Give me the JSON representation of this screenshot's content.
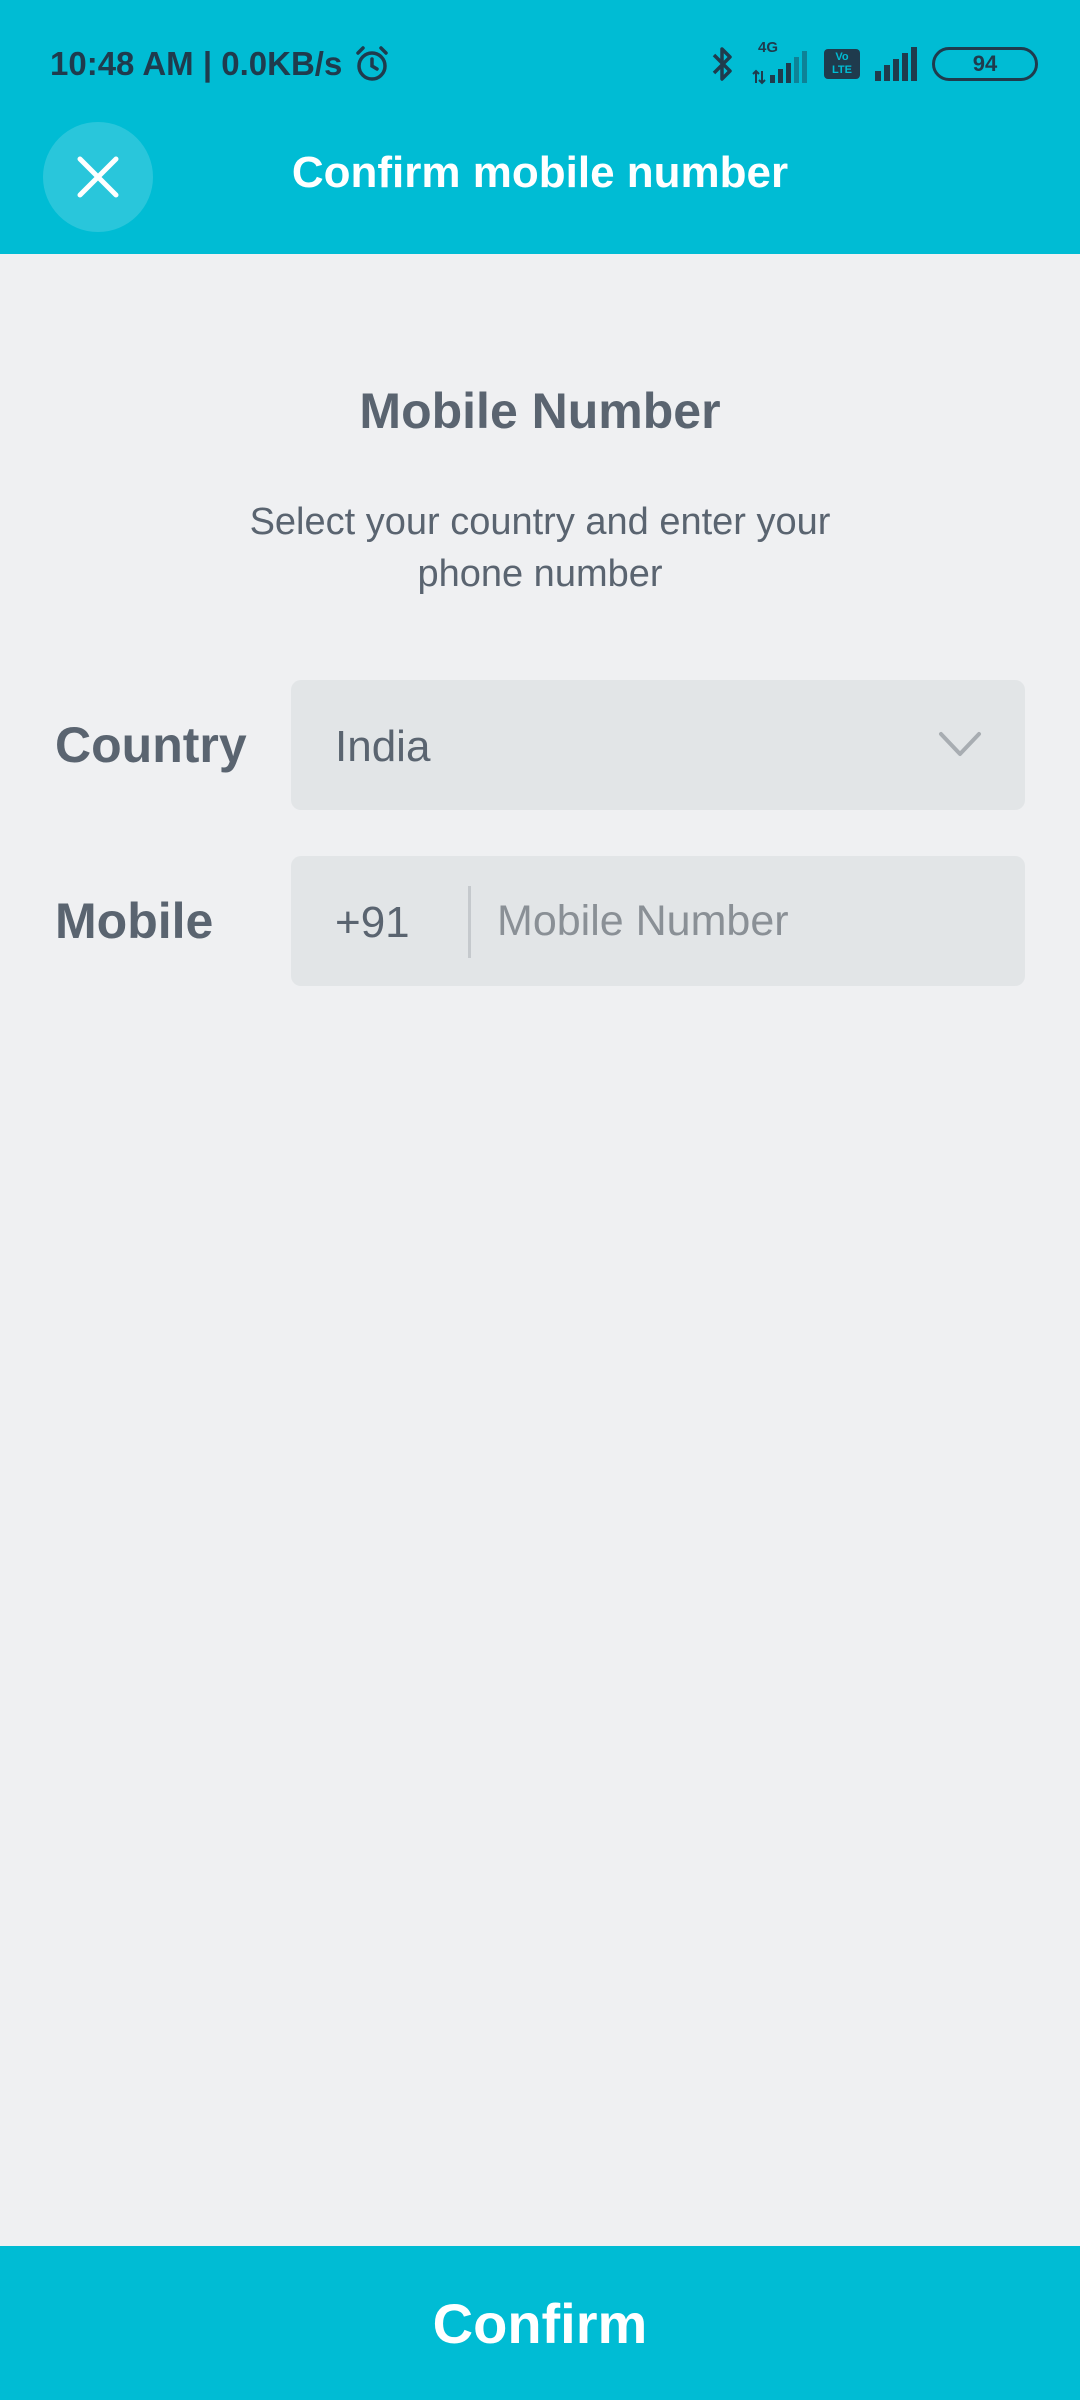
{
  "status_bar": {
    "time_speed": "10:48 AM | 0.0KB/s",
    "network_type": "4G",
    "volte_top": "Vo",
    "volte_bottom": "LTE",
    "battery": "94",
    "icons": [
      "alarm-icon",
      "bluetooth-icon",
      "signal-4g-icon",
      "volte-icon",
      "signal-icon",
      "battery-icon"
    ]
  },
  "header": {
    "title": "Confirm mobile number",
    "close_icon": "close-icon"
  },
  "main": {
    "heading": "Mobile Number",
    "subheading": "Select your country and enter your phone number",
    "country": {
      "label": "Country",
      "value": "India"
    },
    "mobile": {
      "label": "Mobile",
      "dial_code": "+91",
      "placeholder": "Mobile Number",
      "value": ""
    }
  },
  "footer": {
    "confirm_label": "Confirm"
  },
  "colors": {
    "accent": "#00bcd4",
    "background": "#eff0f2",
    "field_bg": "#e2e5e7",
    "text": "#5a6470"
  }
}
